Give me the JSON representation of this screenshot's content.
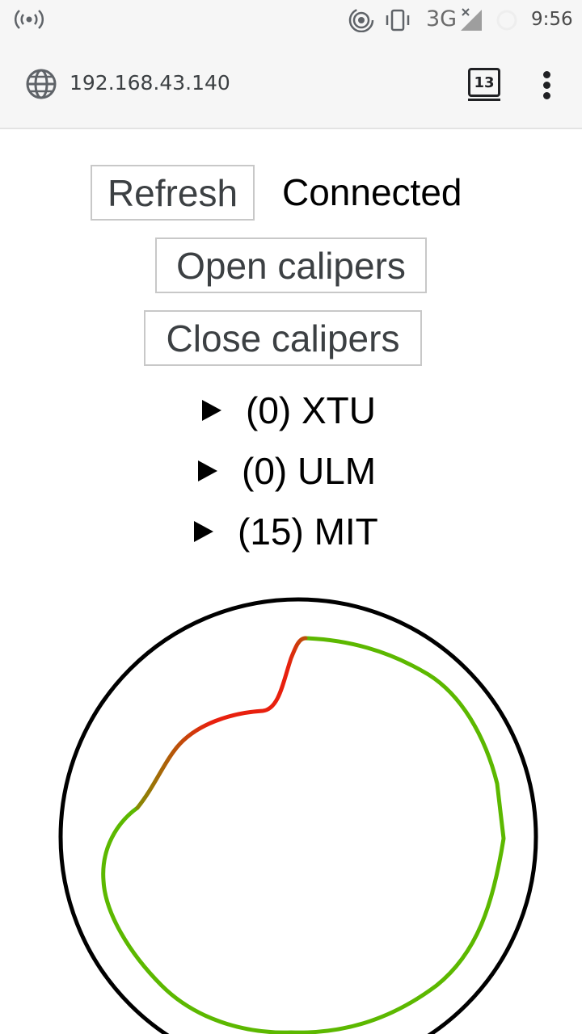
{
  "status_bar": {
    "network": "3G",
    "time": "9:56"
  },
  "browser": {
    "url": "192.168.43.140",
    "tab_count": "13"
  },
  "page": {
    "refresh_label": "Refresh",
    "connection_status": "Connected",
    "open_label": "Open calipers",
    "close_label": "Close calipers",
    "sections": [
      {
        "label": "(0) XTU"
      },
      {
        "label": "(0) ULM"
      },
      {
        "label": "(15) MIT"
      }
    ]
  },
  "colors": {
    "outline_circle": "#000000",
    "trace_green": "#5cb800",
    "trace_red": "#e8200e"
  }
}
